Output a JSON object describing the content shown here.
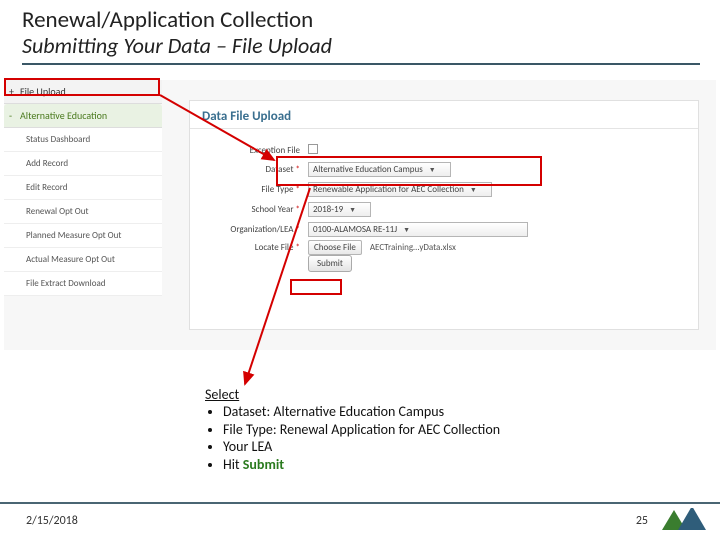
{
  "title": {
    "main": "Renewal/Application Collection",
    "sub": "Submitting Your Data – File Upload"
  },
  "sidebar": {
    "upload": "File Upload",
    "alted": "Alternative Education",
    "items": [
      "Status Dashboard",
      "Add Record",
      "Edit Record",
      "Renewal Opt Out",
      "Planned Measure Opt Out",
      "Actual Measure Opt Out",
      "File Extract Download"
    ]
  },
  "panel": {
    "title": "Data File Upload",
    "labels": {
      "exception": "Exception File",
      "dataset": "Dataset",
      "filetype": "File Type",
      "schoolyear": "School Year",
      "org": "Organization/LEA",
      "locate": "Locate File"
    },
    "values": {
      "dataset": "Alternative Education Campus",
      "filetype": "Renewable Application for AEC Collection",
      "schoolyear": "2018-19",
      "org": "0100-ALAMOSA RE-11J",
      "choose": "Choose File",
      "filename": "AECTraining…yData.xlsx",
      "submit": "Submit"
    }
  },
  "instructions": {
    "heading": "Select",
    "items": [
      "Dataset: Alternative Education Campus",
      "File Type: Renewal Application for AEC Collection",
      "Your LEA",
      "Hit "
    ],
    "submit_word": "Submit"
  },
  "footer": {
    "date": "2/15/2018",
    "page": "25"
  }
}
